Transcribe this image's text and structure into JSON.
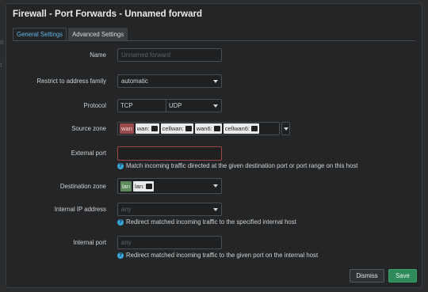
{
  "window": {
    "title": "Firewall - Port Forwards - Unnamed forward"
  },
  "tabs": [
    {
      "label": "General Settings",
      "active": true
    },
    {
      "label": "Advanced Settings",
      "active": false
    }
  ],
  "form": {
    "name": {
      "label": "Name",
      "placeholder": "Unnamed forward",
      "value": ""
    },
    "family": {
      "label": "Restrict to address family",
      "value": "automatic"
    },
    "protocol": {
      "label": "Protocol",
      "values": [
        "TCP",
        "UDP"
      ]
    },
    "source_zone": {
      "label": "Source zone",
      "zone_name": "wan",
      "zone_color": "#9a4a4a",
      "interfaces": [
        "wan:",
        "cellwan:",
        "wan6:",
        "cellwan6:"
      ]
    },
    "external_port": {
      "label": "External port",
      "value": "",
      "help": "Match incoming traffic directed at the given destination port or port range on this host"
    },
    "destination_zone": {
      "label": "Destination zone",
      "zone_name": "lan",
      "zone_color": "#5e8a5e",
      "interfaces": [
        "lan:"
      ]
    },
    "internal_ip": {
      "label": "Internal IP address",
      "placeholder": "any",
      "help": "Redirect matched incoming traffic to the specified internal host"
    },
    "internal_port": {
      "label": "Internal port",
      "placeholder": "any",
      "help": "Redirect matched incoming traffic to the given port on the internal host"
    }
  },
  "footer": {
    "dismiss_label": "Dismiss",
    "save_label": "Save"
  },
  "backdrop": {
    "glyphs": [
      "e",
      "t"
    ]
  },
  "colors": {
    "accent": "#5fb7e8",
    "save": "#2f8a5b",
    "error_border": "#a04444",
    "help": "#3aa3d8"
  }
}
